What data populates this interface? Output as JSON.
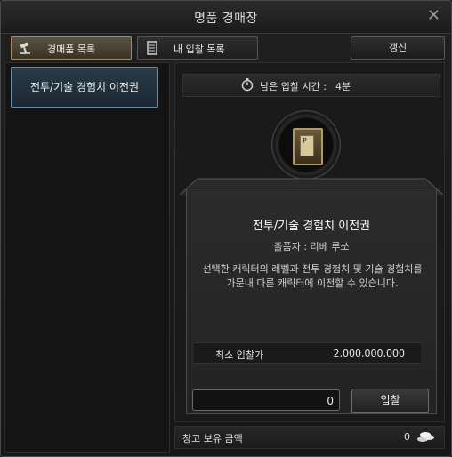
{
  "window": {
    "title": "명품 경매장",
    "close_icon": "close-icon"
  },
  "tabs": [
    {
      "label": "경매품 목록",
      "icon": "gavel-icon",
      "active": true
    },
    {
      "label": "내 입찰 목록",
      "icon": "scroll-icon",
      "active": false
    }
  ],
  "toolbar": {
    "refresh_label": "갱신"
  },
  "list": {
    "items": [
      {
        "label": "전투/기술 경험치 이전권",
        "selected": true
      }
    ]
  },
  "timer": {
    "icon": "stopwatch-icon",
    "label": "남은 입찰 시간 :",
    "value": "4분"
  },
  "item": {
    "icon": "book-icon",
    "name": "전투/기술 경험치 이전권",
    "seller": "출품자 : 리베 루쏘",
    "description_lines": [
      "선택한 캐릭터의 레벨과 전투 경험치 및 기술 경험치를",
      "가문내 다른 캐릭터에 이전할 수 있습니다."
    ]
  },
  "min_bid": {
    "label": "최소 입찰가",
    "value": "2,000,000,000"
  },
  "bid": {
    "input_value": "0",
    "button_label": "입찰"
  },
  "balance": {
    "label": "창고 보유 금액",
    "value": "0",
    "icon": "coins-icon"
  },
  "colors": {
    "accent_border": "#6a8aa8",
    "active_tab": "#5c5142"
  }
}
